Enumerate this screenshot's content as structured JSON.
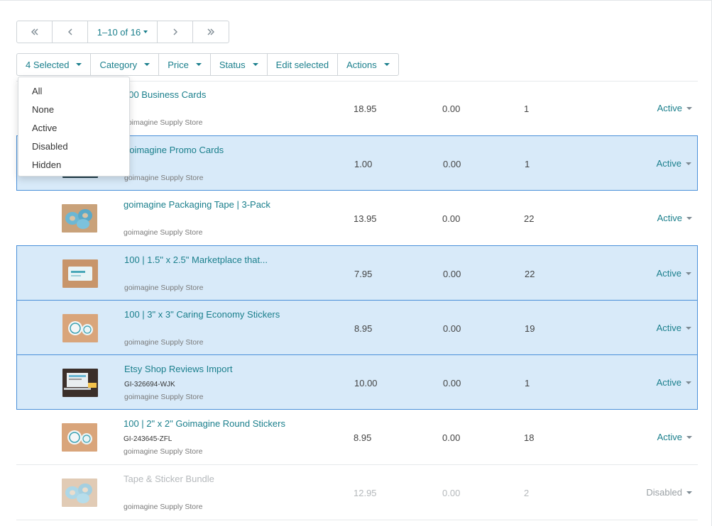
{
  "pagination": {
    "first_icon": "double-chevron-left-icon",
    "prev_icon": "chevron-left-icon",
    "info": "1–10 of 16",
    "next_icon": "chevron-right-icon",
    "last_icon": "double-chevron-right-icon"
  },
  "toolbar": {
    "selected": "4 Selected",
    "category": "Category",
    "price": "Price",
    "status": "Status",
    "edit_selected": "Edit selected",
    "actions": "Actions"
  },
  "select_menu": {
    "options": [
      "All",
      "None",
      "Active",
      "Disabled",
      "Hidden"
    ]
  },
  "products": [
    {
      "name": "100 Business Cards",
      "sku": "",
      "store": "goimagine Supply Store",
      "price": "18.95",
      "cost": "0.00",
      "qty": "1",
      "status": "Active",
      "selected": false,
      "thumb": "card"
    },
    {
      "name": "goimagine Promo Cards",
      "sku": "",
      "store": "goimagine Supply Store",
      "price": "1.00",
      "cost": "0.00",
      "qty": "1",
      "status": "Active",
      "selected": true,
      "thumb": "dark"
    },
    {
      "name": "goimagine Packaging Tape | 3-Pack",
      "sku": "",
      "store": "goimagine Supply Store",
      "price": "13.95",
      "cost": "0.00",
      "qty": "22",
      "status": "Active",
      "selected": false,
      "thumb": "tape"
    },
    {
      "name": "100 | 1.5\" x 2.5\" Marketplace that...",
      "sku": "",
      "store": "goimagine Supply Store",
      "price": "7.95",
      "cost": "0.00",
      "qty": "22",
      "status": "Active",
      "selected": true,
      "thumb": "card"
    },
    {
      "name": "100 | 3\" x 3\" Caring Economy Stickers",
      "sku": "",
      "store": "goimagine Supply Store",
      "price": "8.95",
      "cost": "0.00",
      "qty": "19",
      "status": "Active",
      "selected": true,
      "thumb": "sticker"
    },
    {
      "name": "Etsy Shop Reviews Import",
      "sku": "GI-326694-WJK",
      "store": "goimagine Supply Store",
      "price": "10.00",
      "cost": "0.00",
      "qty": "1",
      "status": "Active",
      "selected": true,
      "thumb": "laptop"
    },
    {
      "name": "100 | 2\" x 2\" Goimagine Round Stickers",
      "sku": "GI-243645-ZFL",
      "store": "goimagine Supply Store",
      "price": "8.95",
      "cost": "0.00",
      "qty": "18",
      "status": "Active",
      "selected": false,
      "thumb": "sticker"
    },
    {
      "name": "Tape & Sticker Bundle",
      "sku": "",
      "store": "goimagine Supply Store",
      "price": "12.95",
      "cost": "0.00",
      "qty": "2",
      "status": "Disabled",
      "selected": false,
      "thumb": "tape"
    }
  ]
}
